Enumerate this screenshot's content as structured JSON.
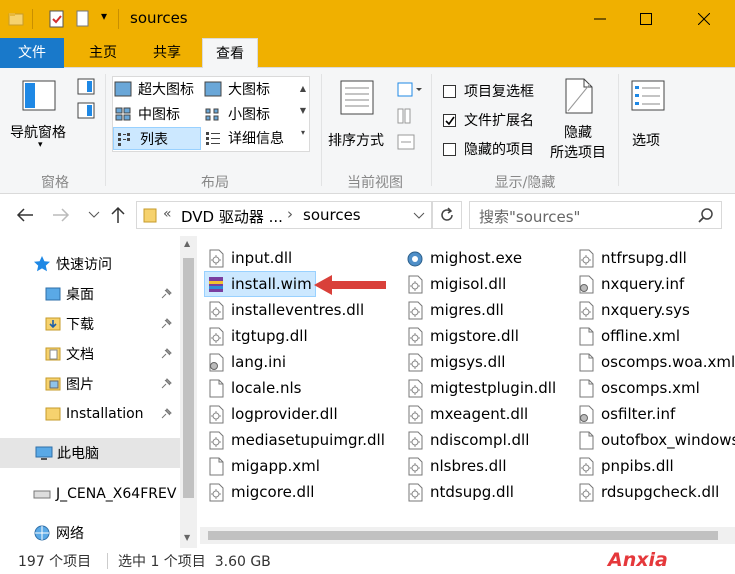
{
  "window": {
    "title": "sources",
    "accent": "#f0b000",
    "quick_access_dropdown": "▾"
  },
  "tabs": [
    "文件",
    "主页",
    "共享",
    "查看"
  ],
  "ribbon": {
    "panes_group": {
      "nav_pane": "导航窗格",
      "label": "窗格"
    },
    "layout_group": {
      "items": [
        "超大图标",
        "大图标",
        "中图标",
        "小图标",
        "列表",
        "详细信息"
      ],
      "selected": "列表",
      "label": "布局"
    },
    "current_view_group": {
      "sort_by": "排序方式",
      "label": "当前视图"
    },
    "show_hide_group": {
      "checkboxes": [
        {
          "label": "项目复选框",
          "checked": false
        },
        {
          "label": "文件扩展名",
          "checked": true
        },
        {
          "label": "隐藏的项目",
          "checked": false
        }
      ],
      "hide_selected_line1": "隐藏",
      "hide_selected_line2": "所选项目",
      "label": "显示/隐藏"
    },
    "options": "选项"
  },
  "address": {
    "prefix": "«",
    "crumb1": "DVD 驱动器 ...",
    "sep": "›",
    "crumb2": "sources",
    "search_placeholder": "搜索\"sources\""
  },
  "nav": {
    "quick_access": "快速访问",
    "items": [
      "桌面",
      "下载",
      "文档",
      "图片",
      "Installation"
    ],
    "this_pc": "此电脑",
    "drive": "J_CENA_X64FREV",
    "network": "网络"
  },
  "files": {
    "col1": [
      "input.dll",
      "install.wim",
      "installeventres.dll",
      "itgtupg.dll",
      "lang.ini",
      "locale.nls",
      "logprovider.dll",
      "mediasetupuimgr.dll",
      "migapp.xml",
      "migcore.dll"
    ],
    "col2": [
      "mighost.exe",
      "migisol.dll",
      "migres.dll",
      "migstore.dll",
      "migsys.dll",
      "migtestplugin.dll",
      "mxeagent.dll",
      "ndiscompl.dll",
      "nlsbres.dll",
      "ntdsupg.dll"
    ],
    "col3": [
      "ntfrsupg.dll",
      "nxquery.inf",
      "nxquery.sys",
      "offline.xml",
      "oscomps.woa.xml",
      "oscomps.xml",
      "osfilter.inf",
      "outofbox_windows",
      "pnpibs.dll",
      "rdsupgcheck.dll"
    ],
    "selected": "install.wim"
  },
  "status": {
    "count": "197 个项目",
    "selection": "选中 1 个项目  3.60 GB"
  },
  "watermark": "Anxia",
  "colors": {
    "selection": "#cce8ff",
    "arrow": "#d9403a",
    "folder": "#e8b83a"
  }
}
